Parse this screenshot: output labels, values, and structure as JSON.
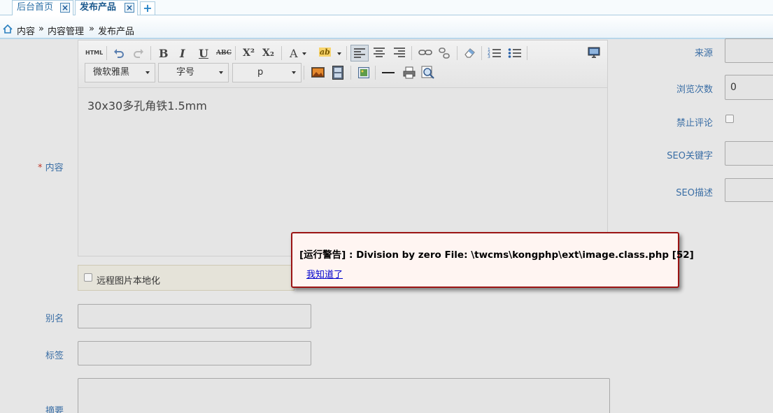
{
  "tabs": [
    {
      "label": "后台首页",
      "active": false
    },
    {
      "label": "发布产品",
      "active": true
    }
  ],
  "tab_add_label": "+",
  "tab_close_glyph": "×",
  "breadcrumb": [
    "内容",
    "»",
    "内容管理",
    "»",
    "发布产品"
  ],
  "editor": {
    "toolbar": {
      "html_label": "HTML",
      "bold": "B",
      "italic": "I",
      "underline": "U",
      "strike": "ABC",
      "superscript": "X²",
      "subscript": "X₂",
      "font_color": "A",
      "highlight": "ab",
      "font_family": "微软雅黑",
      "font_size": "字号",
      "paragraph": "p"
    },
    "content": "30x30多孔角铁1.5mm"
  },
  "form": {
    "content_required_mark": "*",
    "content_label": "内容",
    "remote_images_label": "远程图片本地化",
    "alias_label": "别名",
    "tags_label": "标签",
    "summary_label": "摘要"
  },
  "sidebar_form": {
    "source_label": "来源",
    "views_label": "浏览次数",
    "views_value": "0",
    "no_comment_label": "禁止评论",
    "seo_keywords_label": "SEO关键字",
    "seo_description_label": "SEO描述"
  },
  "alert": {
    "message": "[运行警告] : Division by zero File: \\twcms\\kongphp\\ext\\image.class.php [52]",
    "confirm_link": "我知道了",
    "border_color": "#9b1414"
  }
}
